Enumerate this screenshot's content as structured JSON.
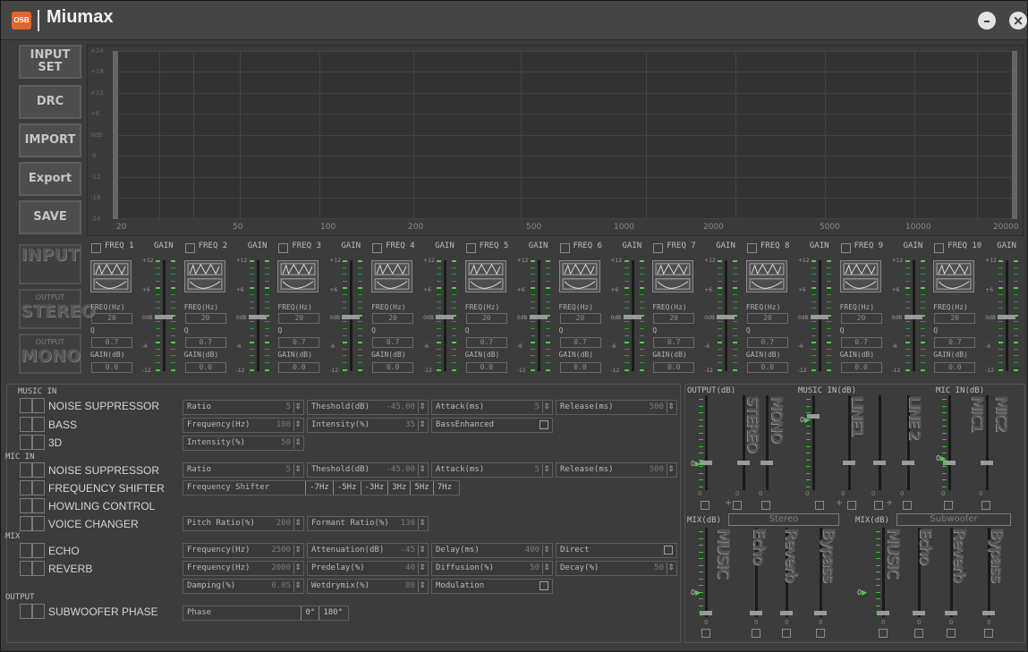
{
  "app": {
    "title": "Miumax",
    "logo_text": "OSB"
  },
  "left_buttons": [
    "INPUT\nSET",
    "DRC",
    "IMPORT",
    "Export",
    "SAVE"
  ],
  "channel_buttons": [
    {
      "small": "",
      "big": "INPUT"
    },
    {
      "small": "OUTPUT",
      "big": "STEREO"
    },
    {
      "small": "OUTPUT",
      "big": "MONO"
    }
  ],
  "eq_graph": {
    "y_labels": [
      "+24",
      "+18",
      "+12",
      "+6",
      "0dB",
      "-6",
      "-12",
      "-18",
      "-24"
    ],
    "x_labels": [
      "20",
      "50",
      "100",
      "200",
      "500",
      "1000",
      "2000",
      "5000",
      "10000",
      "20000"
    ]
  },
  "bands_common": {
    "gain_label": "GAIN",
    "freq_label": "FREQ(Hz)",
    "freq_value": "20",
    "q_label": "Q",
    "q_value": "0.7",
    "gain_db_label": "GAIN(dB)",
    "gain_value": "0.0",
    "scale": [
      "+12",
      "+6",
      "0dB",
      "-6",
      "-12"
    ]
  },
  "bands": [
    "FREQ 1",
    "FREQ 2",
    "FREQ 3",
    "FREQ 4",
    "FREQ 5",
    "FREQ 6",
    "FREQ 7",
    "FREQ 8",
    "FREQ 9",
    "FREQ 10"
  ],
  "sections": {
    "music_in": "MUSIC IN",
    "mic_in": "MIC IN",
    "mix": "MIX",
    "output": "OUTPUT"
  },
  "rows": {
    "noise1": "NOISE SUPPRESSOR",
    "bass": "BASS",
    "threed": "3D",
    "noise2": "NOISE SUPPRESSOR",
    "freqshift": "FREQUENCY SHIFTER",
    "howling": "HOWLING CONTROL",
    "voice": "VOICE CHANGER",
    "echo": "ECHO",
    "reverb": "REVERB",
    "subphase": "SUBWOOFER PHASE"
  },
  "fields": {
    "ns1_ratio": {
      "label": "Ratio",
      "value": "5"
    },
    "ns1_thresh": {
      "label": "Theshold(dB)",
      "value": "-45.00"
    },
    "ns1_attack": {
      "label": "Attack(ms)",
      "value": "5"
    },
    "ns1_release": {
      "label": "Release(ms)",
      "value": "500"
    },
    "bass_freq": {
      "label": "Frequency(Hz)",
      "value": "100"
    },
    "bass_int": {
      "label": "Intensity(%)",
      "value": "35"
    },
    "bass_enh": {
      "label": "BassEnhanced"
    },
    "threed_int": {
      "label": "Intensity(%)",
      "value": "50"
    },
    "ns2_ratio": {
      "label": "Ratio",
      "value": "5"
    },
    "ns2_thresh": {
      "label": "Theshold(dB)",
      "value": "-45.00"
    },
    "ns2_attack": {
      "label": "Attack(ms)",
      "value": "5"
    },
    "ns2_release": {
      "label": "Release(ms)",
      "value": "500"
    },
    "fs": {
      "label": "Frequency Shifter",
      "options": [
        "-7Hz",
        "-5Hz",
        "-3Hz",
        "3Hz",
        "5Hz",
        "7Hz"
      ]
    },
    "vc_pitch": {
      "label": "Pitch Ratio(%)",
      "value": "200"
    },
    "vc_formant": {
      "label": "Formant Ratio(%)",
      "value": "130"
    },
    "echo_freq": {
      "label": "Frequency(Hz)",
      "value": "2500"
    },
    "echo_att": {
      "label": "Attenuation(dB)",
      "value": "-45"
    },
    "echo_delay": {
      "label": "Delay(ms)",
      "value": "400"
    },
    "echo_direct": {
      "label": "Direct"
    },
    "rv_freq": {
      "label": "Frequency(Hz)",
      "value": "2000"
    },
    "rv_predelay": {
      "label": "Predelay(%)",
      "value": "40"
    },
    "rv_diff": {
      "label": "Diffusion(%)",
      "value": "50"
    },
    "rv_decay": {
      "label": "Decay(%)",
      "value": "50"
    },
    "rv_damp": {
      "label": "Damping(%)",
      "value": "0.05"
    },
    "rv_wet": {
      "label": "Wetdrymix(%)",
      "value": "80"
    },
    "rv_mod": {
      "label": "Modulation"
    },
    "phase": {
      "label": "Phase",
      "options": [
        "0°",
        "180°"
      ]
    }
  },
  "mixer": {
    "output_db": "OUTPUT(dB)",
    "music_in_db": "MUSIC IN(dB)",
    "mic_in_db": "MIC IN(dB)",
    "top_channels": [
      "STEREO",
      "MONO",
      "LINE1",
      "LINE 2",
      "MIC1",
      "MIC2"
    ],
    "mix_db": "MIX(dB)",
    "mix_stereo": "Stereo",
    "mix_sub": "Subwoofer",
    "mix_channels": [
      "MUSIC",
      "Echo",
      "Reverb",
      "Bypass",
      "MUSIC",
      "Echo",
      "Reverb",
      "Bypass"
    ],
    "zero": "0",
    "zero_label": "0"
  }
}
